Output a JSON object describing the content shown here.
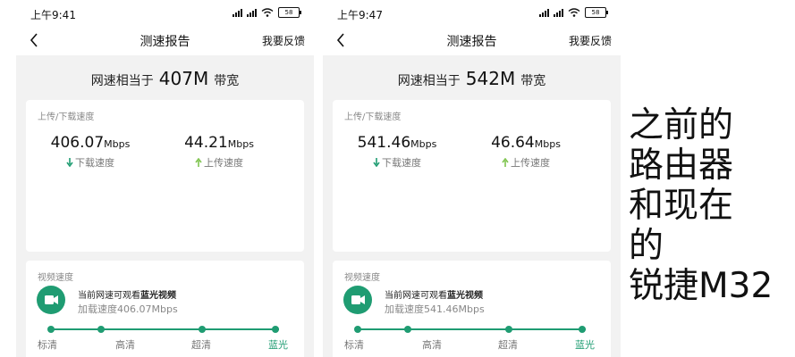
{
  "phones": [
    {
      "status_time": "上午9:41",
      "battery": "58",
      "nav_title": "测速报告",
      "nav_feedback": "我要反馈",
      "bandwidth_prefix": "网速相当于",
      "bandwidth_value": "407M",
      "bandwidth_suffix": "带宽",
      "speed_card_label": "上传/下载速度",
      "download_value": "406.07",
      "download_unit": "Mbps",
      "download_label": "下载速度",
      "upload_value": "44.21",
      "upload_unit": "Mbps",
      "upload_label": "上传速度",
      "video_card_label": "视频速度",
      "video_line_prefix": "当前网速可观看",
      "video_line_quality": "蓝光视频",
      "video_load_speed": "加载速度406.07Mbps",
      "qualities": [
        "标清",
        "高清",
        "超清",
        "蓝光"
      ],
      "active_quality": "蓝光"
    },
    {
      "status_time": "上午9:47",
      "battery": "58",
      "nav_title": "测速报告",
      "nav_feedback": "我要反馈",
      "bandwidth_prefix": "网速相当于",
      "bandwidth_value": "542M",
      "bandwidth_suffix": "带宽",
      "speed_card_label": "上传/下载速度",
      "download_value": "541.46",
      "download_unit": "Mbps",
      "download_label": "下载速度",
      "upload_value": "46.64",
      "upload_unit": "Mbps",
      "upload_label": "上传速度",
      "video_card_label": "视频速度",
      "video_line_prefix": "当前网速可观看",
      "video_line_quality": "蓝光视频",
      "video_load_speed": "加载速度541.46Mbps",
      "qualities": [
        "标清",
        "高清",
        "超清",
        "蓝光"
      ],
      "active_quality": "蓝光"
    }
  ],
  "caption_lines": [
    "之前的",
    "路由器",
    "和现在",
    "的",
    "锐捷M32"
  ],
  "colors": {
    "accent": "#1f9c72",
    "background": "#f2f2f2"
  }
}
